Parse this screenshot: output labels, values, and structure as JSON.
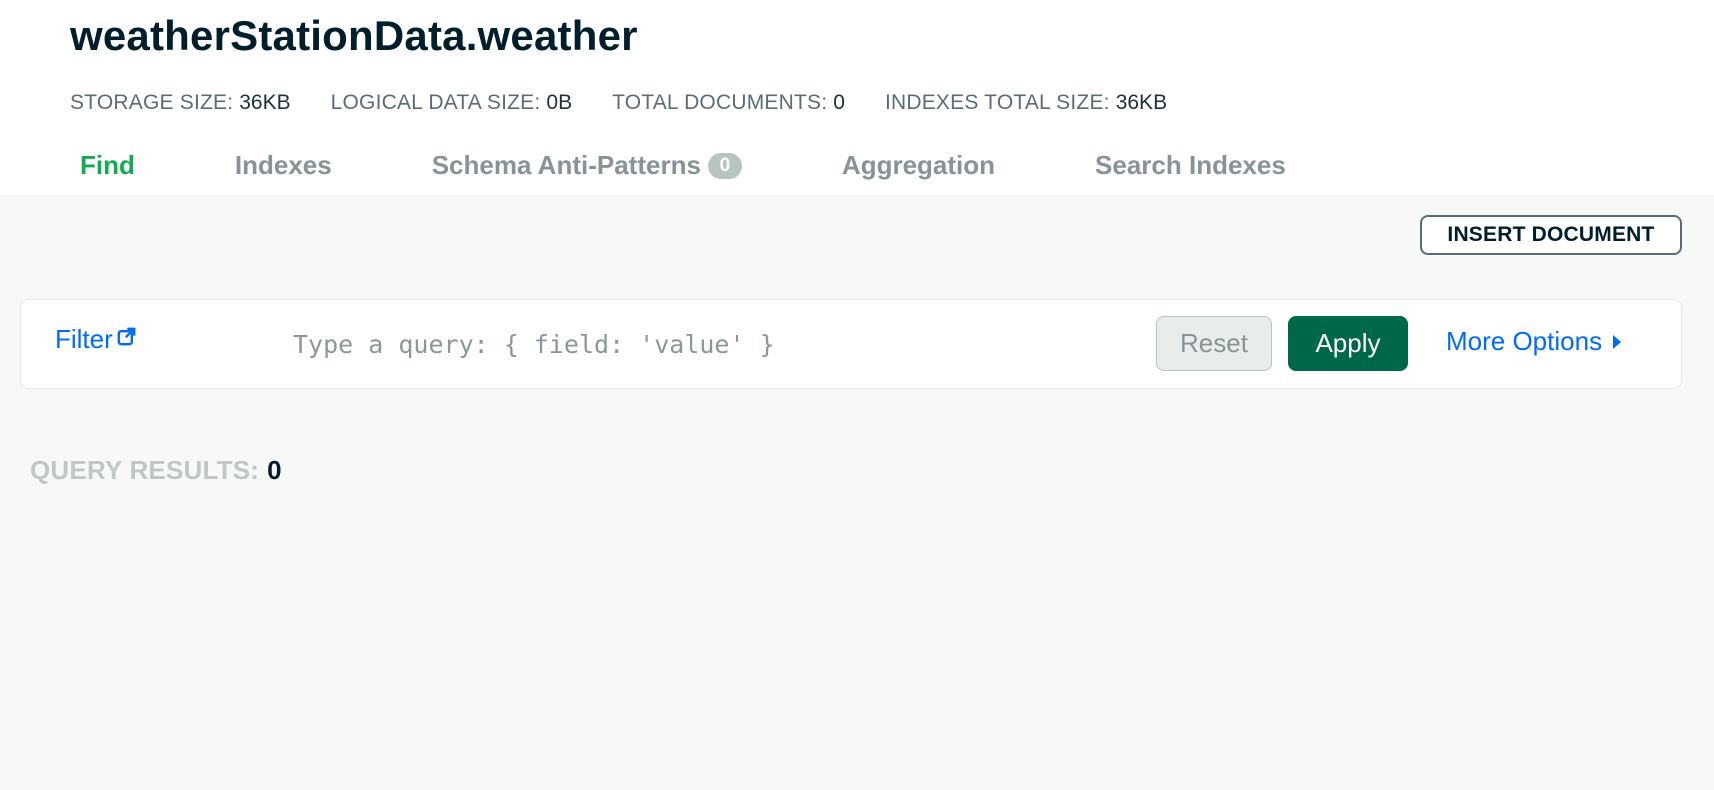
{
  "collection": {
    "title": "weatherStationData.weather"
  },
  "stats": [
    {
      "label": "STORAGE SIZE:",
      "value": "36KB"
    },
    {
      "label": "LOGICAL DATA SIZE:",
      "value": "0B"
    },
    {
      "label": "TOTAL DOCUMENTS:",
      "value": "0"
    },
    {
      "label": "INDEXES TOTAL SIZE:",
      "value": "36KB"
    }
  ],
  "tabs": [
    {
      "label": "Find",
      "active": true
    },
    {
      "label": "Indexes"
    },
    {
      "label": "Schema Anti-Patterns",
      "badge": "0"
    },
    {
      "label": "Aggregation"
    },
    {
      "label": "Search Indexes"
    }
  ],
  "toolbar": {
    "insert_label": "INSERT DOCUMENT"
  },
  "filter": {
    "label": "Filter",
    "placeholder": "Type a query: { field: 'value' }",
    "value": "",
    "reset_label": "Reset",
    "apply_label": "Apply",
    "more_options_label": "More Options"
  },
  "results": {
    "label": "QUERY RESULTS:",
    "count": "0"
  },
  "colors": {
    "accent_green": "#13aa52",
    "apply_green": "#00684a",
    "link_blue": "#016bf8",
    "title_dark": "#001e2b",
    "content_bg": "#f7f9f8"
  },
  "icons": {
    "filter_link": "external-link-icon",
    "more_options": "caret-right-icon"
  }
}
